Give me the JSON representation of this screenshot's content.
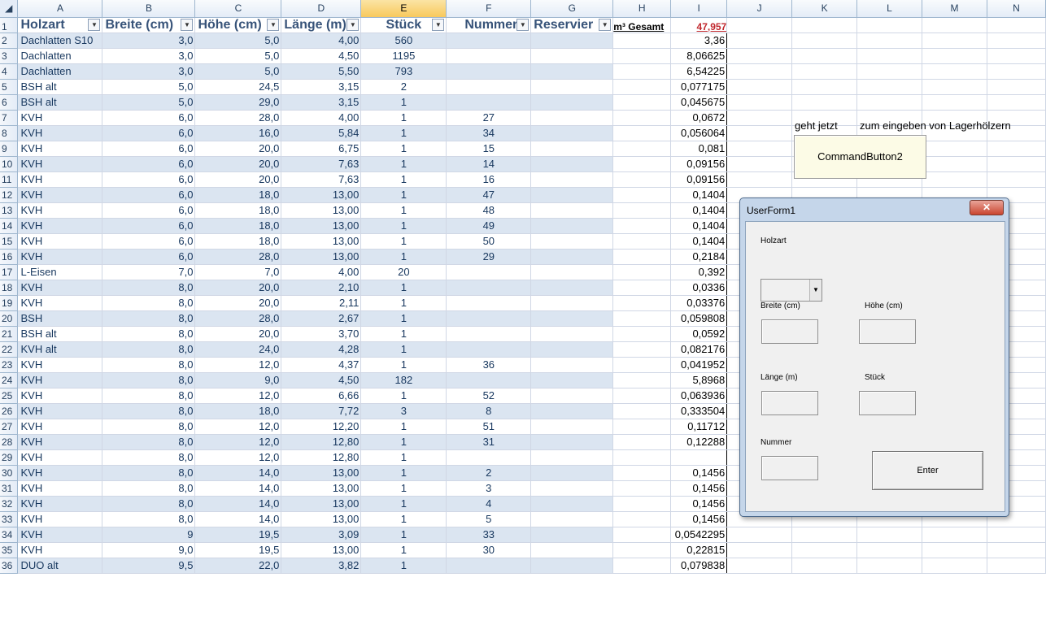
{
  "columns": [
    "A",
    "B",
    "C",
    "D",
    "E",
    "F",
    "G",
    "H",
    "I",
    "J",
    "K",
    "L",
    "M",
    "N"
  ],
  "selected_column": "E",
  "header_row": {
    "row_num": "1",
    "holzart": "Holzart",
    "breite": "Breite (cm)",
    "hoehe": "Höhe (cm)",
    "laenge": "Länge (m)",
    "stueck": "Stück",
    "nummer": "Nummer",
    "reserviert": "Reservier",
    "gesamt": "m³ Gesamt",
    "total": "47,957"
  },
  "filter_icon": "dropdown-filter-icon",
  "rows": [
    {
      "n": "2",
      "a": "Dachlatten S10",
      "b": "3,0",
      "c": "5,0",
      "d": "4,00",
      "e": "560",
      "f": "",
      "i": "3,36"
    },
    {
      "n": "3",
      "a": "Dachlatten",
      "b": "3,0",
      "c": "5,0",
      "d": "4,50",
      "e": "1195",
      "f": "",
      "i": "8,06625"
    },
    {
      "n": "4",
      "a": "Dachlatten",
      "b": "3,0",
      "c": "5,0",
      "d": "5,50",
      "e": "793",
      "f": "",
      "i": "6,54225"
    },
    {
      "n": "5",
      "a": "BSH alt",
      "b": "5,0",
      "c": "24,5",
      "d": "3,15",
      "e": "2",
      "f": "",
      "i": "0,077175"
    },
    {
      "n": "6",
      "a": "BSH alt",
      "b": "5,0",
      "c": "29,0",
      "d": "3,15",
      "e": "1",
      "f": "",
      "i": "0,045675"
    },
    {
      "n": "7",
      "a": "KVH",
      "b": "6,0",
      "c": "28,0",
      "d": "4,00",
      "e": "1",
      "f": "27",
      "i": "0,0672"
    },
    {
      "n": "8",
      "a": "KVH",
      "b": "6,0",
      "c": "16,0",
      "d": "5,84",
      "e": "1",
      "f": "34",
      "i": "0,056064"
    },
    {
      "n": "9",
      "a": "KVH",
      "b": "6,0",
      "c": "20,0",
      "d": "6,75",
      "e": "1",
      "f": "15",
      "i": "0,081"
    },
    {
      "n": "10",
      "a": "KVH",
      "b": "6,0",
      "c": "20,0",
      "d": "7,63",
      "e": "1",
      "f": "14",
      "i": "0,09156"
    },
    {
      "n": "11",
      "a": "KVH",
      "b": "6,0",
      "c": "20,0",
      "d": "7,63",
      "e": "1",
      "f": "16",
      "i": "0,09156"
    },
    {
      "n": "12",
      "a": "KVH",
      "b": "6,0",
      "c": "18,0",
      "d": "13,00",
      "e": "1",
      "f": "47",
      "i": "0,1404"
    },
    {
      "n": "13",
      "a": "KVH",
      "b": "6,0",
      "c": "18,0",
      "d": "13,00",
      "e": "1",
      "f": "48",
      "i": "0,1404"
    },
    {
      "n": "14",
      "a": "KVH",
      "b": "6,0",
      "c": "18,0",
      "d": "13,00",
      "e": "1",
      "f": "49",
      "i": "0,1404"
    },
    {
      "n": "15",
      "a": "KVH",
      "b": "6,0",
      "c": "18,0",
      "d": "13,00",
      "e": "1",
      "f": "50",
      "i": "0,1404"
    },
    {
      "n": "16",
      "a": "KVH",
      "b": "6,0",
      "c": "28,0",
      "d": "13,00",
      "e": "1",
      "f": "29",
      "i": "0,2184"
    },
    {
      "n": "17",
      "a": "L-Eisen",
      "b": "7,0",
      "c": "7,0",
      "d": "4,00",
      "e": "20",
      "f": "",
      "i": "0,392"
    },
    {
      "n": "18",
      "a": "KVH",
      "b": "8,0",
      "c": "20,0",
      "d": "2,10",
      "e": "1",
      "f": "",
      "i": "0,0336"
    },
    {
      "n": "19",
      "a": "KVH",
      "b": "8,0",
      "c": "20,0",
      "d": "2,11",
      "e": "1",
      "f": "",
      "i": "0,03376"
    },
    {
      "n": "20",
      "a": "BSH",
      "b": "8,0",
      "c": "28,0",
      "d": "2,67",
      "e": "1",
      "f": "",
      "i": "0,059808"
    },
    {
      "n": "21",
      "a": "BSH alt",
      "b": "8,0",
      "c": "20,0",
      "d": "3,70",
      "e": "1",
      "f": "",
      "i": "0,0592"
    },
    {
      "n": "22",
      "a": "KVH alt",
      "b": "8,0",
      "c": "24,0",
      "d": "4,28",
      "e": "1",
      "f": "",
      "i": "0,082176"
    },
    {
      "n": "23",
      "a": "KVH",
      "b": "8,0",
      "c": "12,0",
      "d": "4,37",
      "e": "1",
      "f": "36",
      "i": "0,041952"
    },
    {
      "n": "24",
      "a": "KVH",
      "b": "8,0",
      "c": "9,0",
      "d": "4,50",
      "e": "182",
      "f": "",
      "i": "5,8968"
    },
    {
      "n": "25",
      "a": "KVH",
      "b": "8,0",
      "c": "12,0",
      "d": "6,66",
      "e": "1",
      "f": "52",
      "i": "0,063936"
    },
    {
      "n": "26",
      "a": "KVH",
      "b": "8,0",
      "c": "18,0",
      "d": "7,72",
      "e": "3",
      "f": "8",
      "i": "0,333504"
    },
    {
      "n": "27",
      "a": "KVH",
      "b": "8,0",
      "c": "12,0",
      "d": "12,20",
      "e": "1",
      "f": "51",
      "i": "0,11712"
    },
    {
      "n": "28",
      "a": "KVH",
      "b": "8,0",
      "c": "12,0",
      "d": "12,80",
      "e": "1",
      "f": "31",
      "i": "0,12288"
    },
    {
      "n": "29",
      "a": "KVH",
      "b": "8,0",
      "c": "12,0",
      "d": "12,80",
      "e": "1",
      "f": "",
      "i": ""
    },
    {
      "n": "30",
      "a": "KVH",
      "b": "8,0",
      "c": "14,0",
      "d": "13,00",
      "e": "1",
      "f": "2",
      "i": "0,1456"
    },
    {
      "n": "31",
      "a": "KVH",
      "b": "8,0",
      "c": "14,0",
      "d": "13,00",
      "e": "1",
      "f": "3",
      "i": "0,1456"
    },
    {
      "n": "32",
      "a": "KVH",
      "b": "8,0",
      "c": "14,0",
      "d": "13,00",
      "e": "1",
      "f": "4",
      "i": "0,1456"
    },
    {
      "n": "33",
      "a": "KVH",
      "b": "8,0",
      "c": "14,0",
      "d": "13,00",
      "e": "1",
      "f": "5",
      "i": "0,1456"
    },
    {
      "n": "34",
      "a": "KVH",
      "b": "9",
      "c": "19,5",
      "d": "3,09",
      "e": "1",
      "f": "33",
      "i": "0,0542295"
    },
    {
      "n": "35",
      "a": "KVH",
      "b": "9,0",
      "c": "19,5",
      "d": "13,00",
      "e": "1",
      "f": "30",
      "i": "0,22815"
    },
    {
      "n": "36",
      "a": "DUO alt",
      "b": "9,5",
      "c": "22,0",
      "d": "3,82",
      "e": "1",
      "f": "",
      "i": "0,079838"
    }
  ],
  "note": {
    "left": "geht jetzt",
    "right": "zum eingeben von Lagerhölzern"
  },
  "command_button": "CommandButton2",
  "userform": {
    "title": "UserForm1",
    "close": "✕",
    "holzart_label": "Holzart",
    "breite_label": "Breite (cm)",
    "hoehe_label": "Höhe (cm)",
    "laenge_label": "Länge (m)",
    "stueck_label": "Stück",
    "nummer_label": "Nummer",
    "enter_label": "Enter",
    "combo_arrow": "▼"
  },
  "colors": {
    "band": "#dbe5f1",
    "header_text": "#375379",
    "total": "#c0272d",
    "selected_header": "#f8c95d"
  }
}
